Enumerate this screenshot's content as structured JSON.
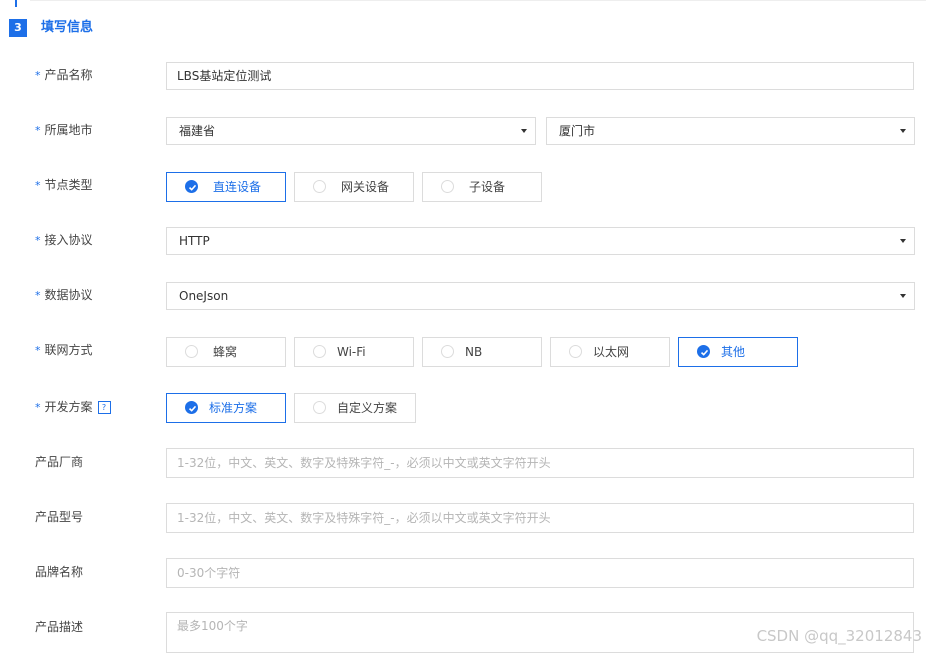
{
  "section": {
    "step": "3",
    "title": "填写信息"
  },
  "fields": {
    "product_name": {
      "label": "产品名称",
      "value": "LBS基站定位测试"
    },
    "location": {
      "label": "所属地市",
      "province": "福建省",
      "city": "厦门市"
    },
    "node_type": {
      "label": "节点类型",
      "options": [
        "直连设备",
        "网关设备",
        "子设备"
      ],
      "selected": "直连设备"
    },
    "access_protocol": {
      "label": "接入协议",
      "value": "HTTP"
    },
    "data_protocol": {
      "label": "数据协议",
      "value": "OneJson"
    },
    "network": {
      "label": "联网方式",
      "options": [
        "蜂窝",
        "Wi-Fi",
        "NB",
        "以太网",
        "其他"
      ],
      "selected": "其他"
    },
    "dev_plan": {
      "label": "开发方案",
      "help": "?",
      "options": [
        "标准方案",
        "自定义方案"
      ],
      "selected": "标准方案"
    },
    "manufacturer": {
      "label": "产品厂商",
      "placeholder": "1-32位，中文、英文、数字及特殊字符_-，必须以中文或英文字符开头"
    },
    "model": {
      "label": "产品型号",
      "placeholder": "1-32位，中文、英文、数字及特殊字符_-，必须以中文或英文字符开头"
    },
    "brand": {
      "label": "品牌名称",
      "placeholder": "0-30个字符"
    },
    "description": {
      "label": "产品描述",
      "placeholder": "最多100个字"
    }
  },
  "required_mark": "*",
  "watermark": "CSDN @qq_32012843",
  "colors": {
    "accent": "#1d6fe8",
    "border": "#dcdcdc",
    "placeholder": "#b5b5b5"
  }
}
